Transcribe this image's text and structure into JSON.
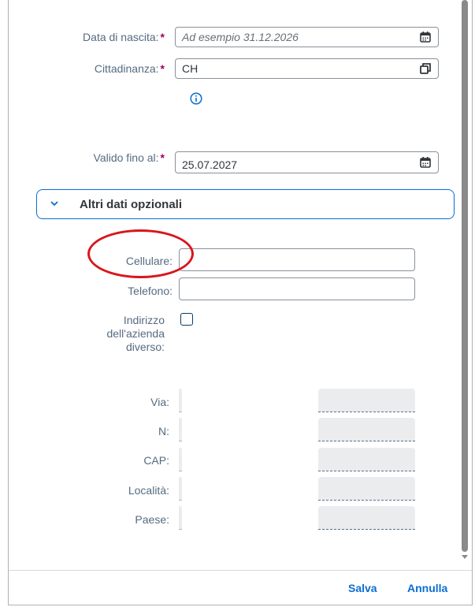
{
  "form": {
    "birth_date": {
      "label": "Data di nascita:",
      "required": "*",
      "placeholder": "Ad esempio 31.12.2026",
      "icon": "calendar-icon"
    },
    "citizenship": {
      "label": "Cittadinanza:",
      "required": "*",
      "value": "CH",
      "icon": "value-help-icon"
    },
    "info_icon": "info-icon",
    "valid_until": {
      "label": "Valido fino al:",
      "required": "*",
      "value": "25.07.2027",
      "icon": "calendar-icon"
    }
  },
  "optional_section": {
    "title": "Altri dati opzionali",
    "expanded": true,
    "mobile": {
      "label": "Cellulare:",
      "value": ""
    },
    "phone": {
      "label": "Telefono:",
      "value": ""
    },
    "different_address": {
      "label_line1": "Indirizzo",
      "label_line2": "dell'azienda",
      "label_line3": "diverso:",
      "checked": false
    },
    "street": {
      "label": "Via:"
    },
    "number": {
      "label": "N:"
    },
    "zip": {
      "label": "CAP:"
    },
    "city": {
      "label": "Località:"
    },
    "country": {
      "label": "Paese:"
    }
  },
  "footer": {
    "save_label": "Salva",
    "cancel_label": "Annulla"
  },
  "colors": {
    "accent": "#0a6ed1",
    "required": "#a1005a",
    "annotation": "#d9161c"
  }
}
